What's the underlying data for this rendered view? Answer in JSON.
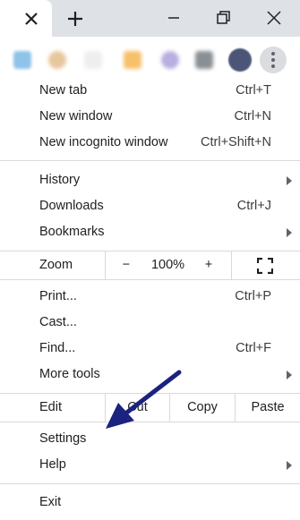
{
  "window": {
    "tab_close_icon": "close-icon",
    "new_tab_icon": "plus-icon",
    "controls": [
      "minimize-icon",
      "restore-icon",
      "close-icon"
    ]
  },
  "toolbar": {
    "menu_icon": "three-dots-vertical-icon",
    "accent": "#dadce0"
  },
  "menu": {
    "new_tab": {
      "label": "New tab",
      "shortcut": "Ctrl+T"
    },
    "new_window": {
      "label": "New window",
      "shortcut": "Ctrl+N"
    },
    "new_incognito": {
      "label": "New incognito window",
      "shortcut": "Ctrl+Shift+N"
    },
    "history": {
      "label": "History"
    },
    "downloads": {
      "label": "Downloads",
      "shortcut": "Ctrl+J"
    },
    "bookmarks": {
      "label": "Bookmarks"
    },
    "zoom": {
      "label": "Zoom",
      "minus": "−",
      "level": "100%",
      "plus": "+"
    },
    "print": {
      "label": "Print...",
      "shortcut": "Ctrl+P"
    },
    "cast": {
      "label": "Cast..."
    },
    "find": {
      "label": "Find...",
      "shortcut": "Ctrl+F"
    },
    "more_tools": {
      "label": "More tools"
    },
    "edit": {
      "label": "Edit",
      "cut": "Cut",
      "copy": "Copy",
      "paste": "Paste"
    },
    "settings": {
      "label": "Settings"
    },
    "help": {
      "label": "Help"
    },
    "exit": {
      "label": "Exit"
    }
  },
  "annotation": {
    "arrow_color": "#1a237e"
  }
}
